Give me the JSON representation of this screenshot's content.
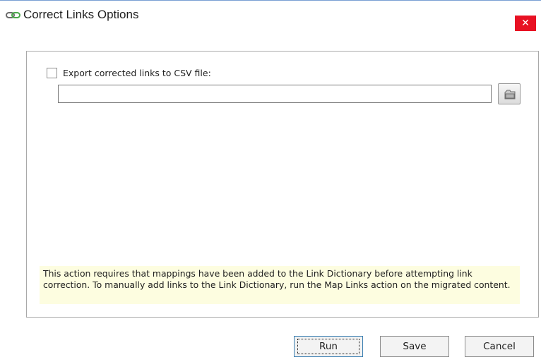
{
  "window": {
    "title": "Correct Links Options",
    "close_label": "✕",
    "title_icon": "link-chain-icon"
  },
  "options": {
    "export_checkbox_checked": false,
    "export_label": "Export corrected links to CSV file:",
    "export_path_value": "",
    "browse_icon": "folder-browse-icon",
    "info_text": "This action requires that mappings have been added to the Link Dictionary before attempting link correction. To manually add links to the Link Dictionary, run the Map Links action on the migrated content."
  },
  "buttons": {
    "run_label": "Run",
    "save_label": "Save",
    "cancel_label": "Cancel"
  },
  "colors": {
    "close_button": "#e81123",
    "info_background": "#fdfde0",
    "titlebar_border": "#7aa0d4"
  }
}
